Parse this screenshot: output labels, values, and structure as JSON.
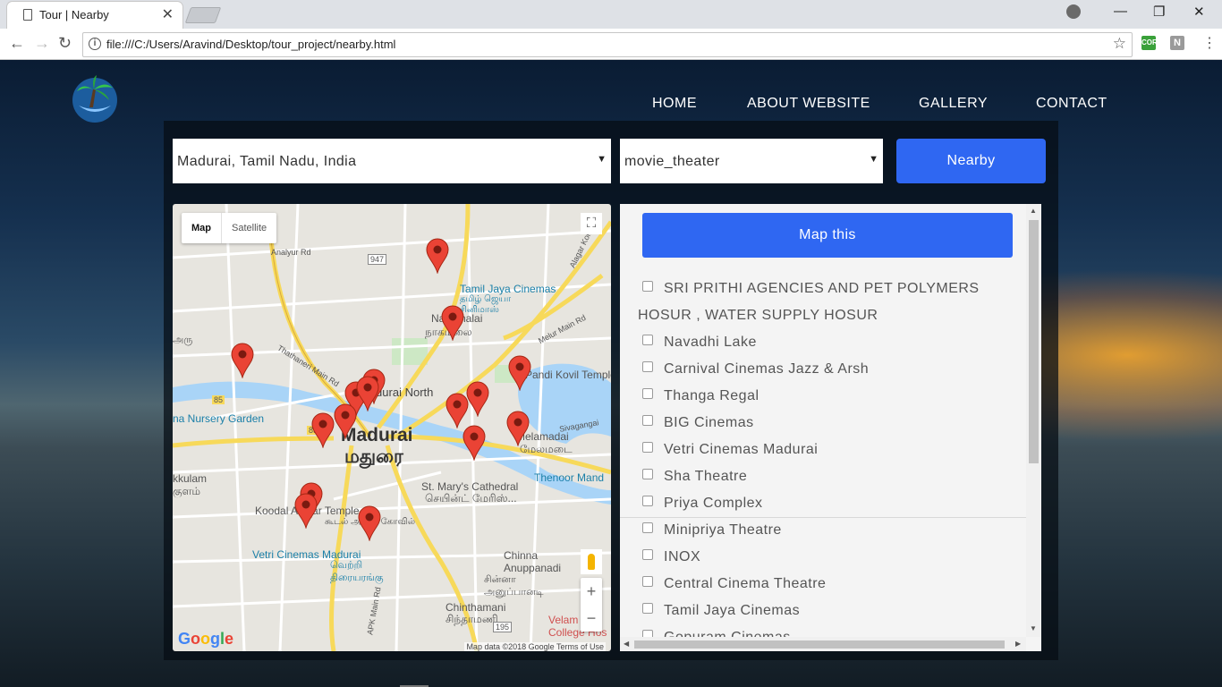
{
  "browser": {
    "tab_title": "Tour | Nearby",
    "url": "file:///C:/Users/Aravind/Desktop/tour_project/nearby.html",
    "ext_cors": "CORS",
    "ext_n": "N"
  },
  "nav": {
    "items": [
      "HOME",
      "ABOUT WEBSITE",
      "GALLERY",
      "CONTACT"
    ]
  },
  "search": {
    "location": "Madurai, Tamil Nadu, India",
    "type": "movie_theater",
    "nearby_label": "Nearby"
  },
  "map": {
    "type_map": "Map",
    "type_satellite": "Satellite",
    "google": "Google",
    "attribution": "Map data ©2018 Google    Terms of Use",
    "labels": {
      "madurai": "Madurai",
      "madurai_ta": "மதுரை",
      "madurai_north": "Madurai North",
      "tamil_jaya": "Tamil Jaya Cinemas",
      "tamil_jaya_ta": "தமிழ் ஜெயா சினிமாஸ்",
      "nagamalai": "Nagamalai",
      "nagamalai_ta": "நாகமலை",
      "pandi": "Pandi Kovil Temple",
      "melamadai": "Melamadai",
      "melamadai_ta": "மேலமடை",
      "thenoor": "Thenoor Mand",
      "stmarys": "St. Mary's Cathedral",
      "stmarys_ta": "செயின்ட் மேரிஸ்...",
      "koodal": "Koodal Alagar Temple",
      "koodal_ta": "கூடல் அழகர் கோவில்",
      "vetri": "Vetri Cinemas Madurai",
      "vetri_ta": "வெற்றி திரையரங்கு",
      "nursery": "na Nursery Garden",
      "kkulam": "kkulam",
      "kkulam_ta": "குளம்",
      "chinna": "Chinna Anuppanadi",
      "chinna_ta": "சின்னா அனுப்பானடி",
      "chinthamani": "Chinthamani",
      "chinthamani_ta": "சிந்தாமணி",
      "velam": "Velam College Hos",
      "analyur": "Analyur Rd",
      "road_947": "947",
      "road_85": "85",
      "road_85b": "85",
      "thathaneri": "Thathaneri Main Rd",
      "melur": "Melur Main Rd",
      "alagar": "Alagar Koil Rd",
      "apk": "APK Main Rd",
      "sivagangai": "Sivagangai",
      "road_195": "195",
      "aru_ta": "அரு"
    }
  },
  "list": {
    "map_this": "Map this",
    "items": [
      "SRI PRITHI AGENCIES AND PET POLYMERS HOSUR , WATER SUPPLY HOSUR",
      "Navadhi Lake",
      "Carnival Cinemas Jazz & Arsh",
      "Thanga Regal",
      "BIG Cinemas",
      "Vetri Cinemas Madurai",
      "Sha Theatre",
      "Priya Complex",
      "Minipriya Theatre",
      "INOX",
      "Central Cinema Theatre",
      "Tamil Jaya Cinemas",
      "Gopuram Cinemas"
    ]
  },
  "colors": {
    "accent": "#2f67f2",
    "pin": "#ea4335"
  }
}
